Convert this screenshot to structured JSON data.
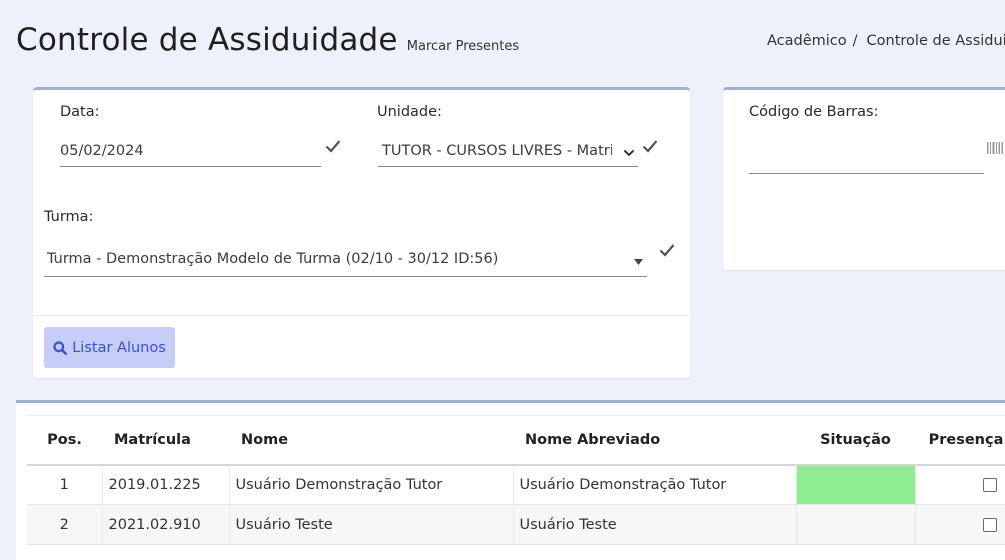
{
  "header": {
    "title": "Controle de Assiduidade",
    "subtitle": "Marcar Presentes"
  },
  "breadcrumb": {
    "items": [
      "Acadêmico",
      "Controle de Assiduidade"
    ],
    "separator": "/"
  },
  "filters": {
    "data_label": "Data:",
    "data_value": "05/02/2024",
    "unidade_label": "Unidade:",
    "unidade_value": "TUTOR - CURSOS LIVRES - Matriz - Tutor",
    "turma_label": "Turma:",
    "turma_value": "Turma - Demonstração Modelo de Turma (02/10 - 30/12 ID:56)",
    "listar_button": "Listar Alunos"
  },
  "barcode": {
    "label": "Código de Barras:",
    "value": ""
  },
  "table": {
    "columns": [
      "Pos.",
      "Matrícula",
      "Nome",
      "Nome Abreviado",
      "Situação",
      "Presença"
    ],
    "rows": [
      {
        "pos": "1",
        "matricula": "2019.01.225",
        "nome": "Usuário Demonstração Tutor",
        "abreviado": "Usuário Demonstração Tutor",
        "situacao": "",
        "presenca": false
      },
      {
        "pos": "2",
        "matricula": "2021.02.910",
        "nome": "Usuário Teste",
        "abreviado": "Usuário Teste",
        "situacao": "",
        "presenca": false
      }
    ]
  },
  "colors": {
    "accent": "#3a4fd6",
    "button_bg": "#c6cdf7",
    "card_border": "#a3aed8",
    "page_bg": "#eef0fb",
    "situacao_ok": "#90ee90"
  },
  "icons": [
    "check-icon",
    "chevron-down-icon",
    "caret-down-icon",
    "barcode-icon",
    "search-icon"
  ]
}
